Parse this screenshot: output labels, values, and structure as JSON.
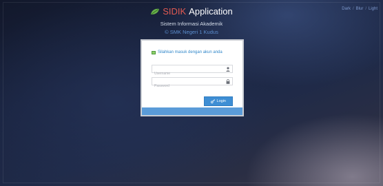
{
  "theme_switch": {
    "items": [
      "Dark",
      "Blur",
      "Light"
    ],
    "separator": "/"
  },
  "header": {
    "brand_red": "SIDIK",
    "brand_white": "Application",
    "subtitle": "Sistem Informasi Akademik",
    "school": "© SMK Negeri 1 Kudus"
  },
  "login": {
    "heading": "Silahkan masuk dengan akun anda",
    "username_placeholder": "Username",
    "password_placeholder": "Password",
    "button_label": "Login"
  },
  "colors": {
    "brand_red": "#e15a52",
    "accent_blue": "#3e8ed4",
    "leaf_green": "#6ab04c"
  },
  "icons": {
    "brand": "leaf-icon",
    "heading": "flag-icon",
    "username": "user-icon",
    "password": "lock-icon",
    "button": "key-icon"
  }
}
